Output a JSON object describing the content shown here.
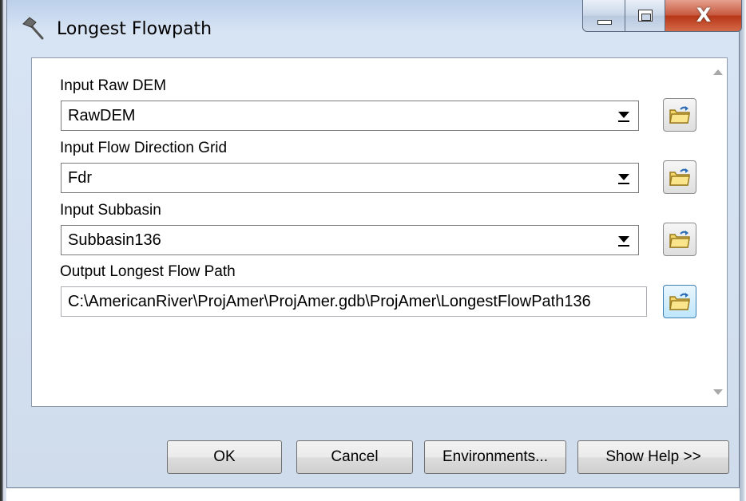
{
  "window": {
    "title": "Longest Flowpath",
    "icon": "hammer-icon",
    "caption_buttons": [
      "minimize",
      "maximize",
      "close"
    ],
    "close_glyph": "X"
  },
  "fields": [
    {
      "label": "Input Raw DEM",
      "value": "RawDEM",
      "type": "combo"
    },
    {
      "label": "Input Flow Direction Grid",
      "value": "Fdr",
      "type": "combo"
    },
    {
      "label": "Input Subbasin",
      "value": "Subbasin136",
      "type": "combo"
    },
    {
      "label": "Output Longest Flow Path",
      "value": "C:\\AmericanRiver\\ProjAmer\\ProjAmer.gdb\\ProjAmer\\LongestFlowPath136",
      "type": "text"
    }
  ],
  "buttons": {
    "ok": "OK",
    "cancel": "Cancel",
    "environments": "Environments...",
    "show_help": "Show Help >>"
  },
  "colors": {
    "titlebar": "#bcd0ea",
    "close": "#c75a40",
    "focus": "#3c7fb1"
  }
}
